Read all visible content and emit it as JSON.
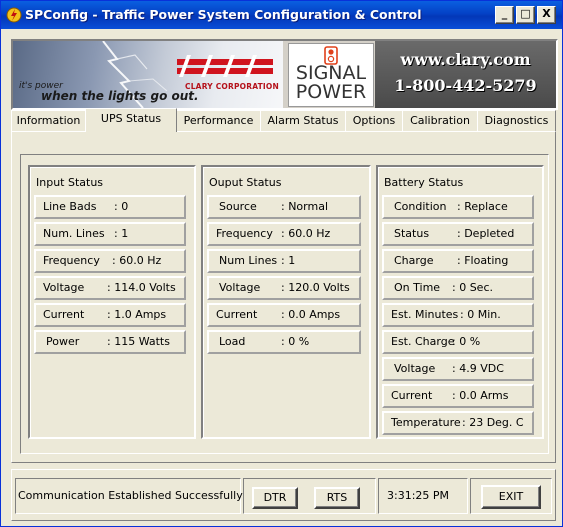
{
  "window": {
    "title": "SPConfig - Traffic Power System Configuration & Control",
    "minimize": "_",
    "restore": "□",
    "close": "X"
  },
  "banner": {
    "slogan_small": "it's power",
    "slogan_main": "when the lights go out.",
    "logo_text": "CLARY",
    "logo_sub": "CLARY CORPORATION",
    "signal1": "SIGNAL",
    "signal2": "POWER",
    "url": "www.clary.com",
    "phone": "1-800-442-5279"
  },
  "tabs": [
    "Information",
    "UPS Status",
    "Performance",
    "Alarm Status",
    "Options",
    "Calibration",
    "Diagnostics"
  ],
  "active_tab": "UPS Status",
  "input_status": {
    "title": "Input Status",
    "rows": [
      {
        "label": "Line Bads",
        "value": ":  0"
      },
      {
        "label": "Num. Lines",
        "value": ":  1"
      },
      {
        "label": "Frequency",
        "value": ": 60.0  Hz"
      },
      {
        "label": "Voltage",
        "value": ":  114.0 Volts"
      },
      {
        "label": "Current",
        "value": ":  1.0 Amps"
      },
      {
        "label": "Power",
        "value": ":  115  Watts"
      }
    ]
  },
  "output_status": {
    "title": "Ouput Status",
    "rows": [
      {
        "label": "Source",
        "value": ":  Normal"
      },
      {
        "label": "Frequency",
        "value": ":  60.0  Hz"
      },
      {
        "label": "Num Lines",
        "value": ":  1"
      },
      {
        "label": "Voltage",
        "value": ":  120.0  Volts"
      },
      {
        "label": "Current",
        "value": ":  0.0  Amps"
      },
      {
        "label": "Load",
        "value": ":  0  %"
      }
    ]
  },
  "battery_status": {
    "title": "Battery Status",
    "rows": [
      {
        "label": "Condition",
        "value": ": Replace"
      },
      {
        "label": "Status",
        "value": ": Depleted"
      },
      {
        "label": "Charge",
        "value": ": Floating"
      },
      {
        "label": "On Time",
        "value": ":  0 Sec."
      },
      {
        "label": "Est. Minutes",
        "value": ": 0  Min."
      },
      {
        "label": "Est. Charge",
        "value": ": 0  %"
      },
      {
        "label": "Voltage",
        "value": ":  4.9  VDC"
      },
      {
        "label": "Current",
        "value": ":  0.0  Arms"
      },
      {
        "label": "Temperature",
        "value": ":  23  Deg. C"
      }
    ]
  },
  "statusbar": {
    "message": "Communication Established Successfully",
    "dtr": "DTR",
    "rts": "RTS",
    "time": "3:31:25 PM",
    "exit": "EXIT"
  },
  "colors": {
    "titlebar": "#0a5fe0",
    "clary_red": "#d0141e",
    "face": "#ece9d8"
  }
}
